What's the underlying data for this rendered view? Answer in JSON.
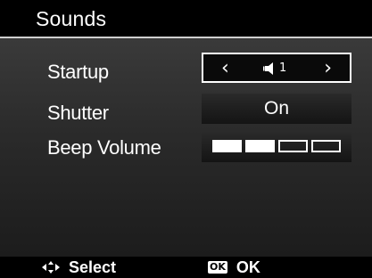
{
  "header": {
    "title": "Sounds"
  },
  "settings": {
    "startup": {
      "label": "Startup",
      "value": "1",
      "left_arrow": "‹",
      "right_arrow": "›",
      "icon": "speaker-icon",
      "selected": true
    },
    "shutter": {
      "label": "Shutter",
      "value": "On"
    },
    "beep_volume": {
      "label": "Beep Volume",
      "level": 2,
      "max_level": 4
    }
  },
  "footer": {
    "select_icon": "four-way-nav-icon",
    "select_label": "Select",
    "ok_badge": "OK",
    "ok_label": "OK"
  },
  "colors": {
    "background": "#000000",
    "panel_top": "#3a3a3a",
    "panel_bottom": "#1c1c1c",
    "text": "#ffffff",
    "selection_border": "#ffffff"
  }
}
